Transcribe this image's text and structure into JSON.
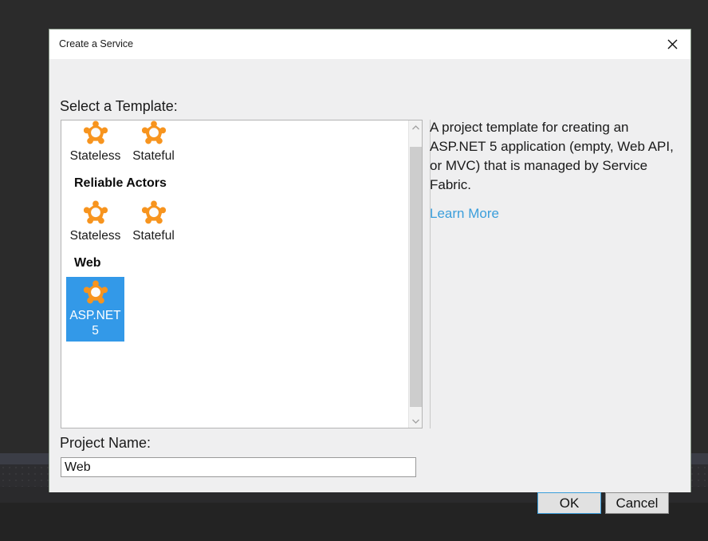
{
  "window": {
    "title": "Create a Service",
    "close_icon": "close-icon"
  },
  "labels": {
    "select_template": "Select a Template:",
    "project_name": "Project Name:"
  },
  "template_list": {
    "groups": [
      {
        "header": null,
        "items": [
          {
            "label": "Stateless",
            "icon": "service-fabric-icon",
            "selected": false
          },
          {
            "label": "Stateful",
            "icon": "service-fabric-icon",
            "selected": false
          }
        ]
      },
      {
        "header": "Reliable Actors",
        "items": [
          {
            "label": "Stateless",
            "icon": "service-fabric-icon",
            "selected": false
          },
          {
            "label": "Stateful",
            "icon": "service-fabric-icon",
            "selected": false
          }
        ]
      },
      {
        "header": "Web",
        "items": [
          {
            "label": "ASP.NET 5",
            "icon": "service-fabric-icon",
            "selected": true
          }
        ]
      }
    ],
    "scrollbar": {
      "up_arrow": "chevron-up-icon",
      "down_arrow": "chevron-down-icon"
    }
  },
  "description": {
    "text": "A project template for creating an ASP.NET 5 application (empty, Web API, or MVC) that is managed by Service Fabric.",
    "link_label": "Learn More"
  },
  "project_name_input": {
    "value": "Web",
    "placeholder": ""
  },
  "buttons": {
    "ok": "OK",
    "cancel": "Cancel"
  },
  "colors": {
    "selection_blue": "#3399e8",
    "link_blue": "#3b9edb",
    "icon_orange": "#f7941e",
    "dialog_background": "#efeff0",
    "desktop_background": "#2b2b2b"
  }
}
